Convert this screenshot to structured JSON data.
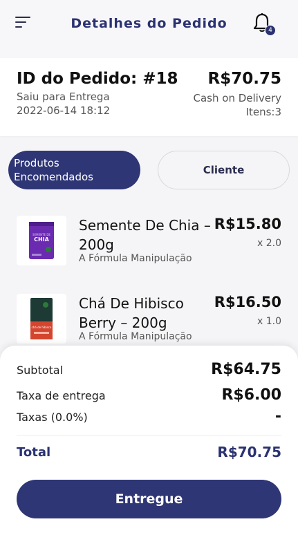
{
  "header": {
    "title": "Detalhes do Pedido",
    "notification_count": "4"
  },
  "order": {
    "id_label": "ID do Pedido: #18",
    "status": "Saiu para Entrega",
    "datetime": "2022-06-14 18:12",
    "total": "R$70.75",
    "payment": "Cash on Delivery",
    "items": "Itens:3"
  },
  "tabs": {
    "products": "Produtos Encomendados",
    "customer": "Cliente"
  },
  "products": [
    {
      "name": "Semente De Chia – 200g",
      "brand": "A Fórmula Manipulação",
      "price": "R$15.80",
      "qty": "x 2.0",
      "package_text": "CHIA",
      "package_color": "#6a2bb0"
    },
    {
      "name": "Chá De Hibisco Berry – 200g",
      "brand": "A Fórmula Manipulação",
      "price": "R$16.50",
      "qty": "x 1.0",
      "package_text": "chá de hibisco",
      "package_color": "#1e3a35"
    }
  ],
  "summary": {
    "subtotal_label": "Subtotal",
    "subtotal_value": "R$64.75",
    "delivery_label": "Taxa de entrega",
    "delivery_value": "R$6.00",
    "taxes_label": "Taxas (0.0%)",
    "taxes_value": "-",
    "total_label": "Total",
    "total_value": "R$70.75"
  },
  "action": {
    "deliver_label": "Entregue"
  },
  "colors": {
    "primary": "#2f3675",
    "title": "#2b3272"
  }
}
